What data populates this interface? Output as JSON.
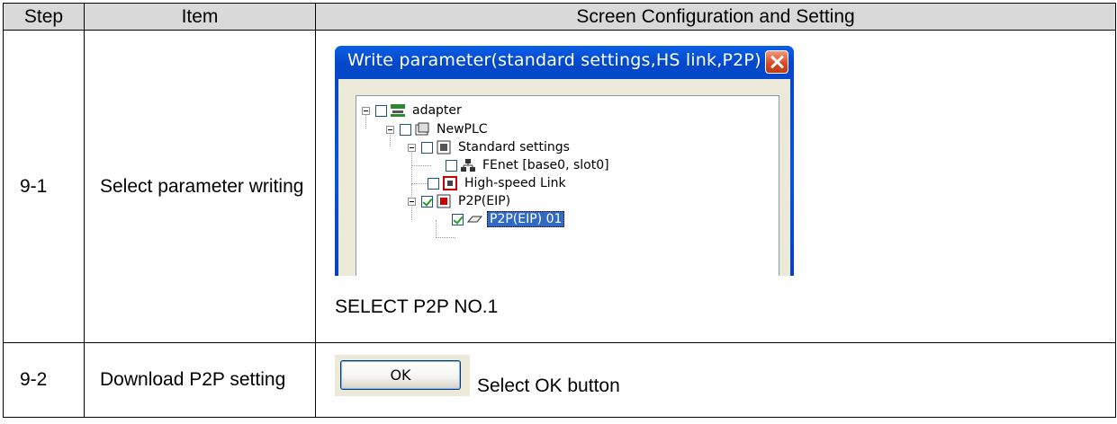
{
  "table": {
    "headers": {
      "step": "Step",
      "item": "Item",
      "screen": "Screen Configuration and Setting"
    },
    "rows": [
      {
        "step": "9-1",
        "item": "Select parameter writing",
        "dialog": {
          "title": "Write parameter(standard settings,HS link,P2P)",
          "tree": [
            {
              "label": "adapter",
              "icon": "network-icon",
              "checked": false,
              "expanded": true
            },
            {
              "label": "NewPLC",
              "icon": "plc-icon",
              "checked": false,
              "expanded": true
            },
            {
              "label": "Standard settings",
              "icon": "settings-module-icon",
              "checked": false,
              "expanded": true
            },
            {
              "label": "FEnet [base0, slot0]",
              "icon": "fenet-icon",
              "checked": false
            },
            {
              "label": "High-speed Link",
              "icon": "hs-link-icon",
              "checked": false
            },
            {
              "label": "P2P(EIP)",
              "icon": "p2p-module-icon",
              "checked": true,
              "expanded": true
            },
            {
              "label": "P2P(EIP) 01",
              "icon": "p2p-block-icon",
              "checked": true,
              "selected": true
            }
          ]
        },
        "caption": "SELECT P2P NO.1"
      },
      {
        "step": "9-2",
        "item": "Download P2P setting",
        "button_label": "OK",
        "caption": "Select OK button"
      }
    ]
  },
  "colors": {
    "header_bg": "#d9d9d9",
    "title_bar": "#0a52dd",
    "selection": "#316ac5",
    "check": "#21a121"
  }
}
